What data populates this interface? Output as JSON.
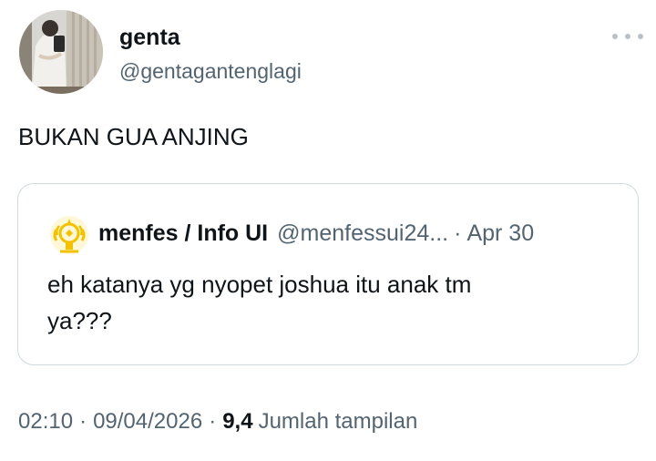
{
  "author": {
    "name": "genta",
    "handle": "@gentaganteng​lagi"
  },
  "tweet": {
    "text": "BUKAN GUA ANJING"
  },
  "quoted_tweet": {
    "author_name": "menfes / Info UI",
    "author_handle": "@menfessui24...",
    "separator": "·",
    "date": "Apr 30",
    "text_line1": "eh katanya yg nyopet joshua itu anak tm",
    "text_line2": "ya???"
  },
  "meta": {
    "time": "02:10",
    "separator": "·",
    "date": "09/04/2026",
    "views_count": "9,4",
    "views_label": "Jumlah tampilan"
  },
  "icons": {
    "more": "more-horizontal-icon",
    "quoted_avatar": "university-emblem-icon"
  },
  "colors": {
    "text": "#0f1419",
    "secondary": "#536471",
    "border": "#cfd9de",
    "emblem": "#f2c200"
  }
}
